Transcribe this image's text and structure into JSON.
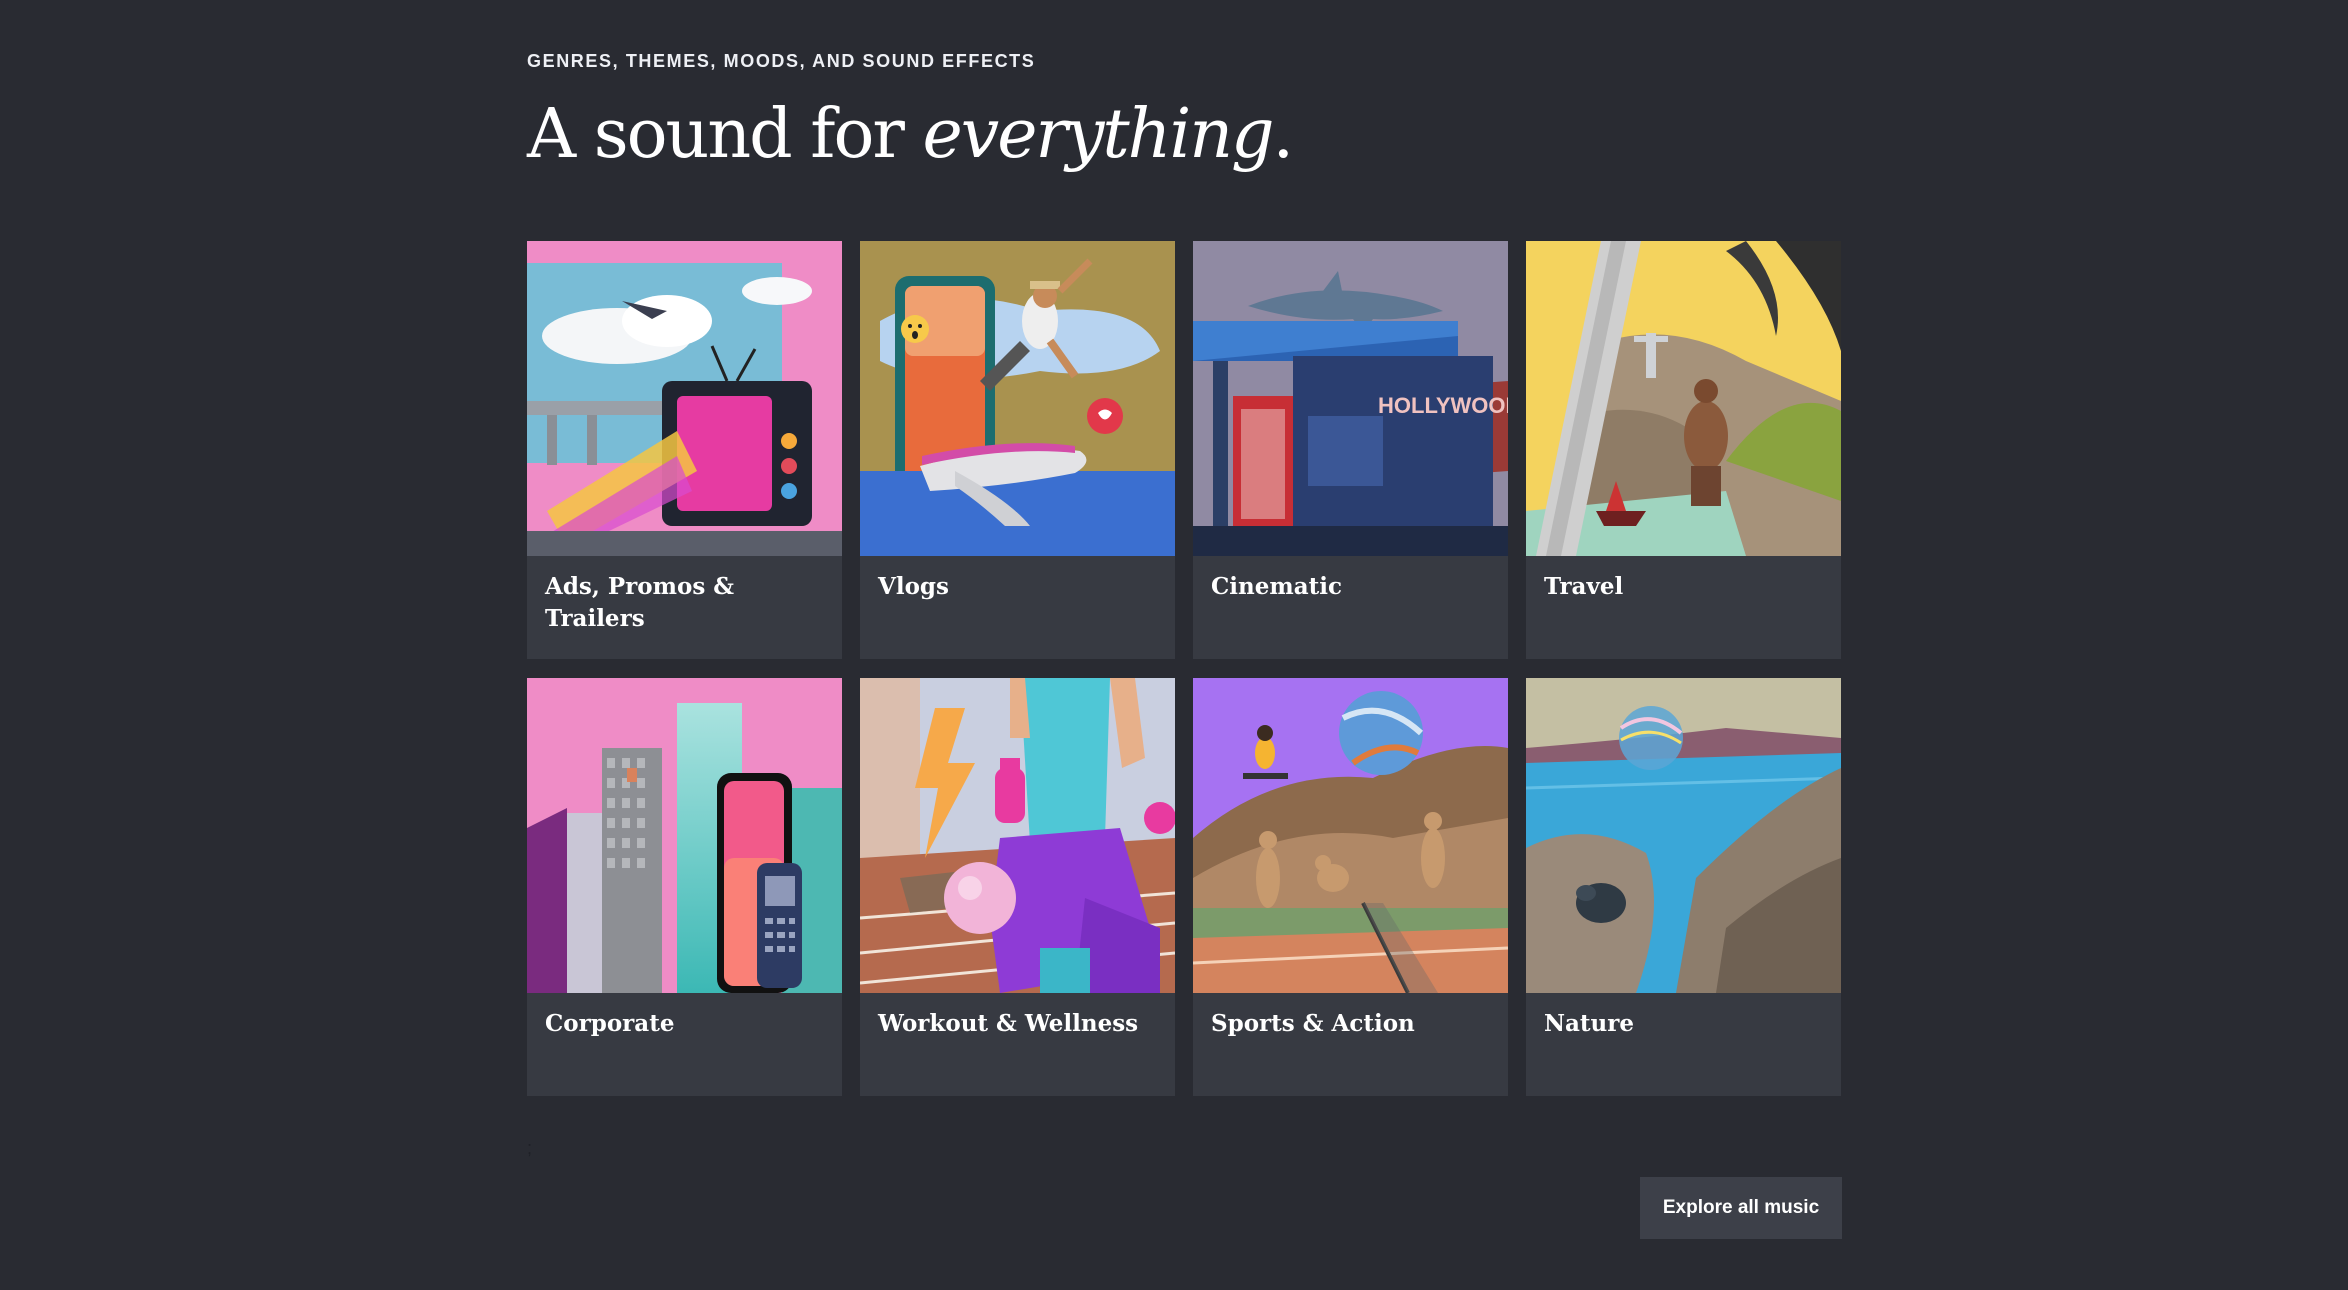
{
  "section": {
    "eyebrow": "GENRES, THEMES, MOODS, AND SOUND EFFECTS",
    "headline_plain": "A sound for ",
    "headline_italic": "everything",
    "headline_end": "."
  },
  "categories": [
    {
      "label": "Ads, Promos & Trailers"
    },
    {
      "label": "Vlogs"
    },
    {
      "label": "Cinematic"
    },
    {
      "label": "Travel"
    },
    {
      "label": "Corporate"
    },
    {
      "label": "Workout & Wellness"
    },
    {
      "label": "Sports & Action"
    },
    {
      "label": "Nature"
    }
  ],
  "stray_text": ";",
  "explore_label": "Explore all music",
  "colors": {
    "background": "#292b32",
    "card": "#373a42",
    "button": "#3d4049"
  }
}
